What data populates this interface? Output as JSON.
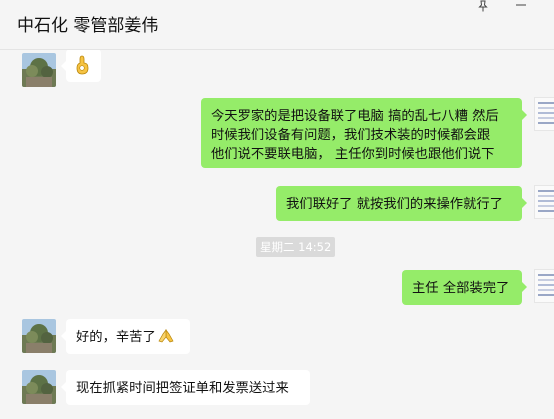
{
  "header": {
    "title": "中石化 零管部姜伟"
  },
  "icons": {
    "pin": "pin-icon",
    "minimize": "minimize-icon",
    "ok_hand": "ok-hand-emoji",
    "pray": "folded-hands-emoji"
  },
  "colors": {
    "outgoing_bubble": "#95ec69",
    "incoming_bubble": "#ffffff",
    "background": "#f5f5f5",
    "timestamp_bg": "#dadada"
  },
  "messages": [
    {
      "sender": "contact",
      "emoji": "ok-hand"
    },
    {
      "sender": "self",
      "lines": [
        "今天罗家的是把设备联了电脑 搞的乱七八糟 然后",
        "时候我们设备有问题，我们技术装的时候都会跟",
        "他们说不要联电脑， 主任你到时候也跟他们说下"
      ]
    },
    {
      "sender": "self",
      "text": "我们联好了 就按我们的来操作就行了"
    },
    {
      "timestamp": "星期二 14:52"
    },
    {
      "sender": "self",
      "text": "主任 全部装完了"
    },
    {
      "sender": "contact",
      "text": "好的，辛苦了",
      "emoji": "pray"
    },
    {
      "sender": "contact",
      "text": "现在抓紧时间把签证单和发票送过来"
    }
  ]
}
